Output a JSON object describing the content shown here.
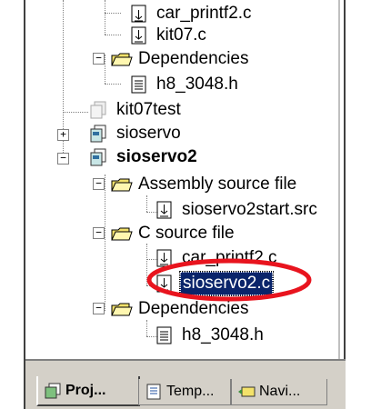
{
  "tree": {
    "items": [
      {
        "label": "car_printf2.c",
        "icon": "c-file-icon",
        "expander": ""
      },
      {
        "label": "kit07.c",
        "icon": "c-file-icon",
        "expander": ""
      },
      {
        "label": "Dependencies",
        "icon": "folder-icon",
        "expander": "−"
      },
      {
        "label": "h8_3048.h",
        "icon": "header-file-icon",
        "expander": ""
      },
      {
        "label": "kit07test",
        "icon": "project-icon-disabled",
        "expander": ""
      },
      {
        "label": "sioservo",
        "icon": "project-icon",
        "expander": "+"
      },
      {
        "label": "sioservo2",
        "icon": "project-icon",
        "expander": "−"
      },
      {
        "label": "Assembly source file",
        "icon": "folder-icon",
        "expander": "−"
      },
      {
        "label": "sioservo2start.src",
        "icon": "c-file-icon",
        "expander": ""
      },
      {
        "label": "C source file",
        "icon": "folder-icon",
        "expander": "−"
      },
      {
        "label": "car_printf2.c",
        "icon": "c-file-icon",
        "expander": ""
      },
      {
        "label": "sioservo2.c",
        "icon": "c-file-icon",
        "expander": ""
      },
      {
        "label": "Dependencies",
        "icon": "folder-icon",
        "expander": "−"
      },
      {
        "label": "h8_3048.h",
        "icon": "header-file-icon",
        "expander": ""
      }
    ]
  },
  "tabs": [
    {
      "label": "Proj...",
      "icon": "project-tab-icon",
      "active": true
    },
    {
      "label": "Temp...",
      "icon": "template-tab-icon",
      "active": false
    },
    {
      "label": "Navi...",
      "icon": "navigator-tab-icon",
      "active": false
    }
  ],
  "colors": {
    "selection": "#0a246a",
    "annotation": "#e8141e",
    "folder": "#f3e26a",
    "panel": "#d4d0c8"
  }
}
